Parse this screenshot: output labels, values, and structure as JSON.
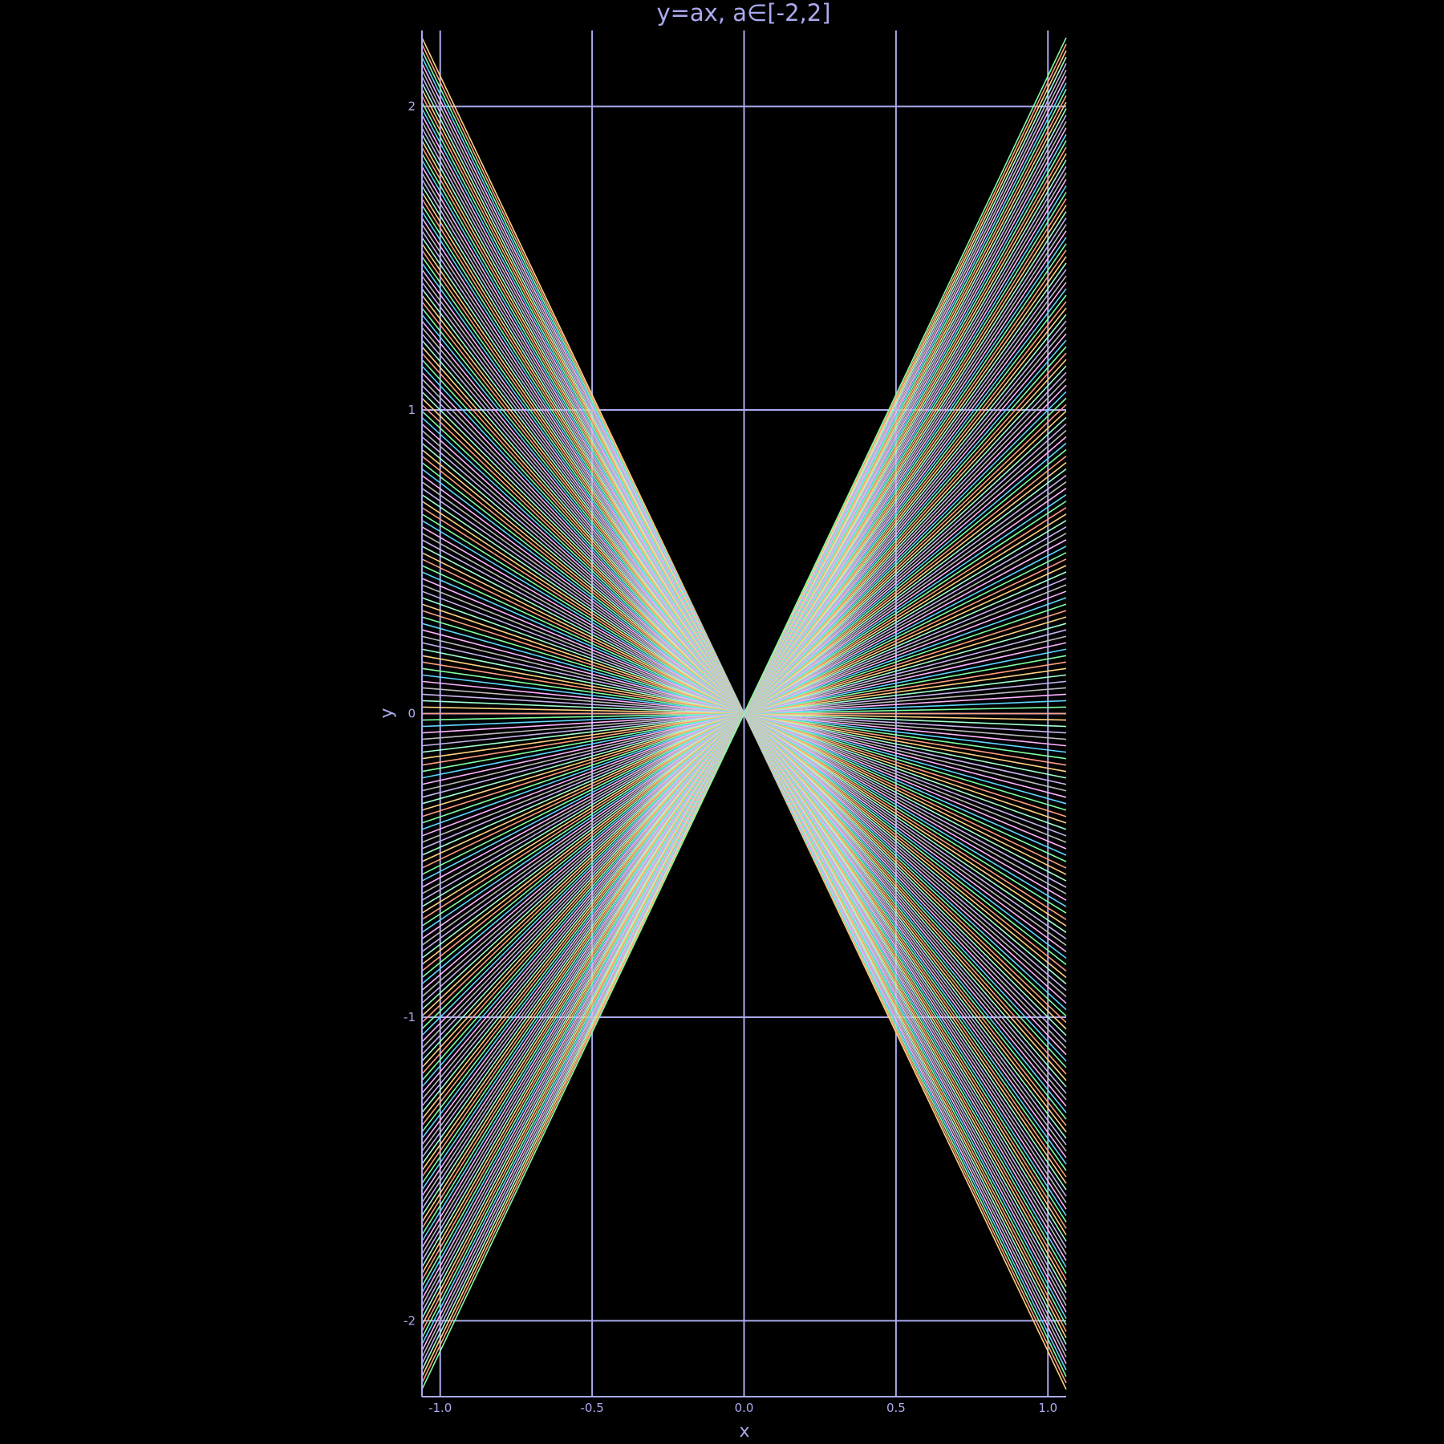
{
  "chart_data": {
    "type": "line",
    "title": "y=ax, a∈[-2,2]",
    "xlabel": "x",
    "ylabel": "y",
    "xlim": [
      -1.06,
      1.06
    ],
    "ylim": [
      -2.25,
      2.25
    ],
    "x_ticks": [
      -1.0,
      -0.5,
      0.0,
      0.5,
      1.0
    ],
    "x_tick_labels": [
      "-1.0",
      "-0.5",
      "0.0",
      "0.5",
      "1.0"
    ],
    "y_ticks": [
      -2,
      -1,
      0,
      1,
      2
    ],
    "y_tick_labels": [
      "-2",
      "-1",
      "0",
      "1",
      "2"
    ],
    "grid": true,
    "legend": "none",
    "x": [
      -1.06,
      1.06
    ],
    "series_rule": "y = a*x",
    "slope_range": [
      -2.1,
      2.1
    ],
    "series_count": 211,
    "colors": {
      "background": "#000000",
      "axis": "#aaaaee",
      "grid": "#aaaaee",
      "text": "#aaaaee",
      "palette": [
        "#ffd27f",
        "#ff9f7f",
        "#7fffa0",
        "#5fd7ff",
        "#ffb3ff",
        "#bbbbbb",
        "#c8b4f0",
        "#a0ffd0"
      ]
    }
  }
}
